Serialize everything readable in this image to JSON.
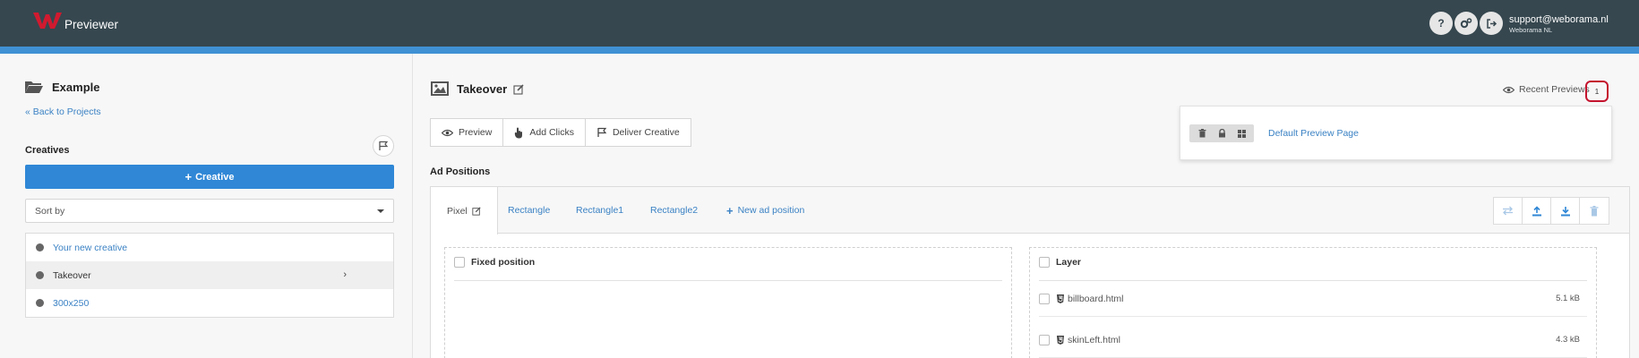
{
  "header": {
    "app_name": "Previewer",
    "user_email": "support@weborama.nl",
    "user_org": "Weborama NL",
    "help_glyph": "?",
    "icons": [
      "help-icon",
      "settings-icon",
      "logout-icon"
    ]
  },
  "colors": {
    "topbar": "#36474f",
    "accent_blue": "#3f91d4",
    "primary_button": "#2f87d6",
    "logo_red": "#d11a2f",
    "highlight_red": "#c4142e"
  },
  "sidebar": {
    "project_title": "Example",
    "back_link": "Back to Projects",
    "creatives_label": "Creatives",
    "add_creative_label": "Creative",
    "sort_placeholder": "Sort by",
    "creatives": [
      {
        "label": "Your new creative",
        "active": false
      },
      {
        "label": "Takeover",
        "active": true
      },
      {
        "label": "300x250",
        "active": false
      }
    ]
  },
  "main": {
    "title": "Takeover",
    "recent_previews_label": "Recent Previews",
    "recent_previews_count": "1",
    "dropdown": {
      "link": "Default Preview Page",
      "tools": [
        "trash-icon",
        "lock-icon",
        "grid-icon"
      ]
    },
    "actions": [
      {
        "label": "Preview",
        "icon": "eye-icon"
      },
      {
        "label": "Add Clicks",
        "icon": "hand-pointer-icon"
      },
      {
        "label": "Deliver Creative",
        "icon": "flag-icon"
      }
    ],
    "ad_positions_label": "Ad Positions",
    "tabs": [
      {
        "label": "Pixel",
        "active": true
      },
      {
        "label": "Rectangle",
        "active": false
      },
      {
        "label": "Rectangle1",
        "active": false
      },
      {
        "label": "Rectangle2",
        "active": false
      }
    ],
    "new_ad_position_label": "New ad position",
    "tab_tools": [
      "swap-icon",
      "upload-icon",
      "download-icon",
      "trash-icon"
    ],
    "fixed_position_label": "Fixed position",
    "layer_label": "Layer",
    "files": [
      {
        "name": "billboard.html",
        "size": "5.1 kB"
      },
      {
        "name": "skinLeft.html",
        "size": "4.3 kB"
      }
    ]
  }
}
